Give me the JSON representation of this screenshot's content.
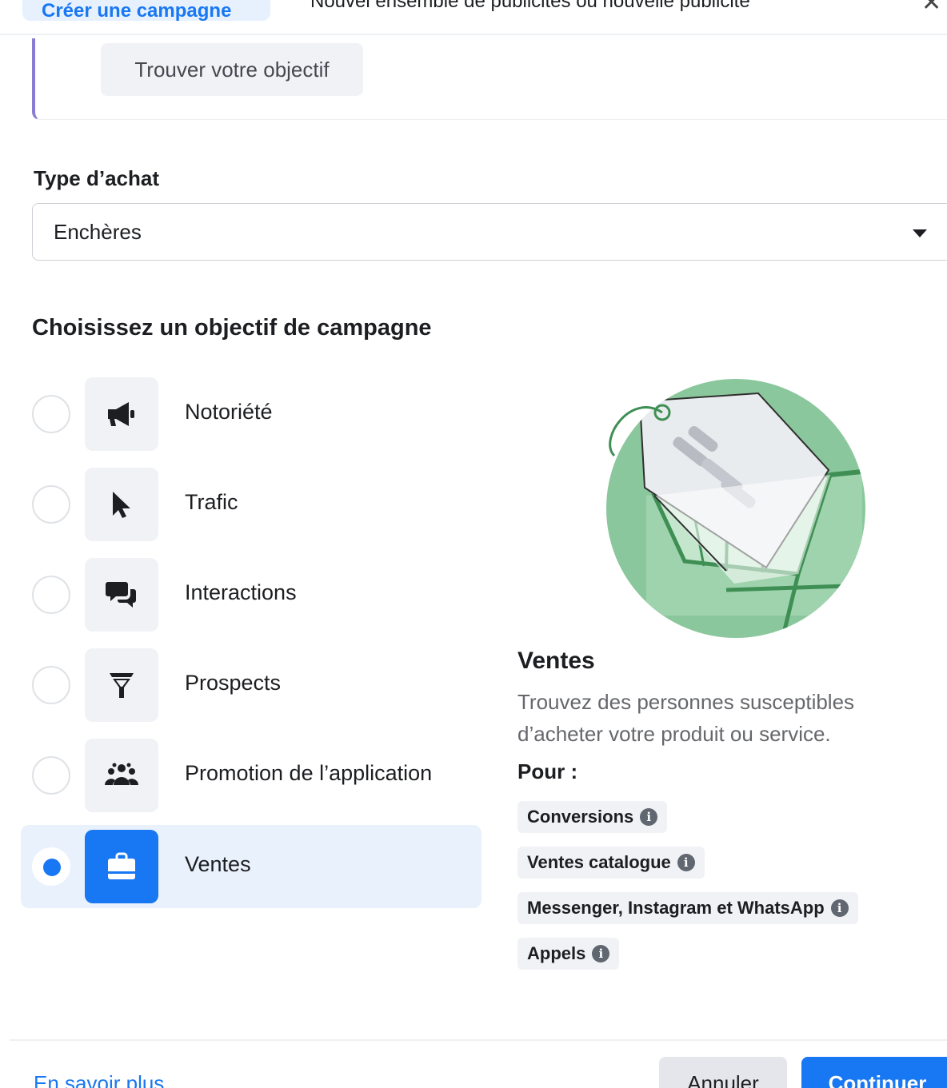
{
  "header": {
    "tab_active": "Créer une campagne",
    "tab_other": "Nouvel ensemble de publicités ou nouvelle publicité"
  },
  "finder": {
    "button_label": "Trouver votre objectif"
  },
  "purchase_type": {
    "label": "Type d’achat",
    "value": "Enchères"
  },
  "objective": {
    "heading": "Choisissez un objectif de campagne",
    "options": [
      {
        "label": "Notoriété",
        "icon": "megaphone-icon",
        "selected": false
      },
      {
        "label": "Trafic",
        "icon": "cursor-icon",
        "selected": false
      },
      {
        "label": "Interactions",
        "icon": "chat-bubbles-icon",
        "selected": false
      },
      {
        "label": "Prospects",
        "icon": "funnel-icon",
        "selected": false
      },
      {
        "label": "Promotion de l’application",
        "icon": "people-icon",
        "selected": false
      },
      {
        "label": "Ventes",
        "icon": "shopping-bag-icon",
        "selected": true
      }
    ]
  },
  "detail": {
    "title": "Ventes",
    "description": "Trouvez des personnes susceptibles d’acheter votre produit ou service.",
    "for_label": "Pour :",
    "chips": [
      "Conversions",
      "Ventes catalogue",
      "Messenger, Instagram et WhatsApp",
      "Appels"
    ]
  },
  "footer": {
    "learn_more": "En savoir plus",
    "cancel": "Annuler",
    "continue": "Continuer"
  },
  "colors": {
    "accent": "#1877f2",
    "selected_bg": "#e9f1fc",
    "illustration_green": "#8bc79c"
  }
}
